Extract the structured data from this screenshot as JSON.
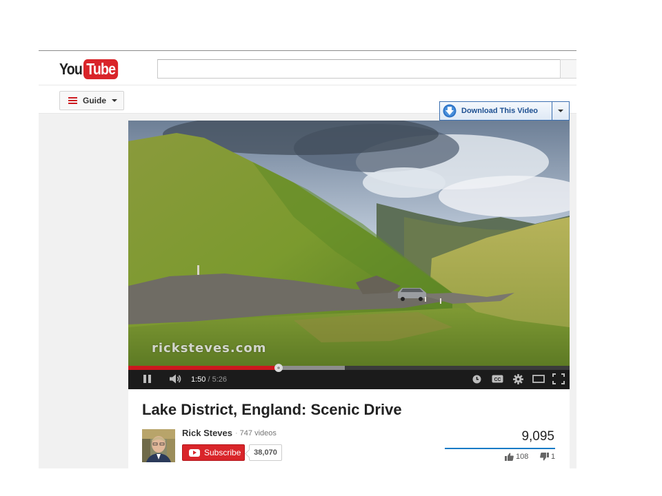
{
  "header": {
    "logo": {
      "you": "You",
      "tube": "Tube"
    },
    "search": {
      "value": "",
      "placeholder": ""
    }
  },
  "guide": {
    "label": "Guide"
  },
  "download": {
    "label": "Download This Video"
  },
  "player": {
    "watermark": "ricksteves.com",
    "time_current": "1:50",
    "time_separator": "/",
    "time_total": "5:26",
    "played_fraction": 0.34,
    "buffered_fraction": 0.49
  },
  "video": {
    "title": "Lake District, England: Scenic Drive",
    "channel": "Rick Steves",
    "video_count": "747 videos",
    "subscribe_label": "Subscribe",
    "subscriber_count": "38,070",
    "views": "9,095",
    "likes": "108",
    "dislikes": "1"
  },
  "colors": {
    "brand_red": "#cc181e",
    "progress_red": "#cc181e",
    "download_blue": "#1d4f91",
    "sentiment_blue": "#167ac6"
  },
  "icons": [
    "guide-menu-icon",
    "download-arrow-icon",
    "pause-icon",
    "volume-icon",
    "watch-later-icon",
    "captions-icon",
    "settings-gear-icon",
    "theater-mode-icon",
    "fullscreen-icon",
    "subscribe-play-icon",
    "thumbs-up-icon",
    "thumbs-down-icon"
  ]
}
